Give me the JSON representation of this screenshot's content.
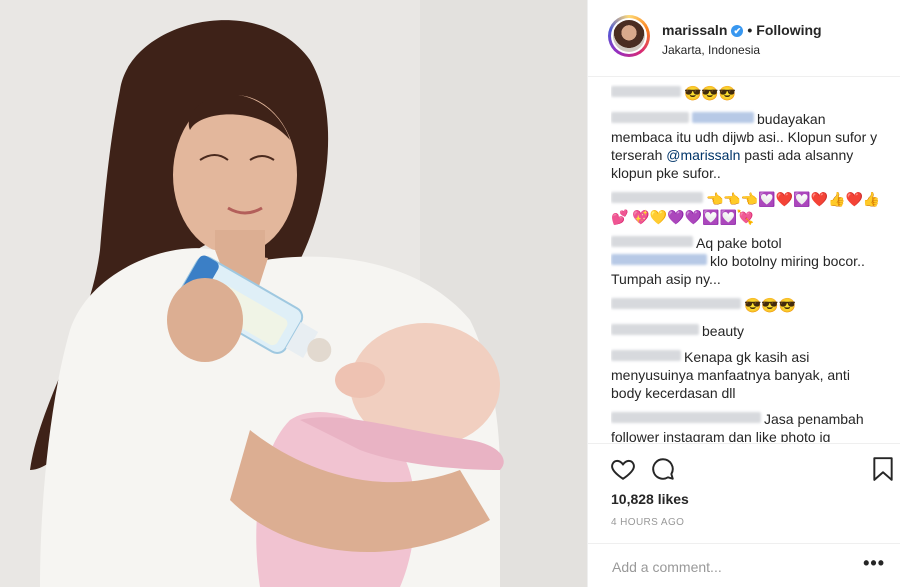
{
  "post": {
    "photo_alt": "Photo of a mother feeding a baby with a bottle",
    "header": {
      "username": "marissaln",
      "verified_glyph": "✔",
      "separator": "•",
      "follow_state": "Following",
      "location": "Jakarta, Indonesia"
    },
    "comments": [
      {
        "text": "😎😎😎"
      },
      {
        "text": "budayakan membaca itu udh dijwb asi.. Klopun sufor y terserah ",
        "mention": "@marissaln",
        "text_after": " pasti ada alsanny klopun pke sufor.."
      },
      {
        "text": "👈👈👈💟❤️💟❤️👍❤️👍💕 💖💛💜💜💟💟💘"
      },
      {
        "text": "Aq pake botol ",
        "text_after": "klo botolny miring bocor.. Tumpah asip ny..."
      },
      {
        "text": "😎😎😎"
      },
      {
        "text": "beauty"
      },
      {
        "text": "Kenapa gk kasih asi menyusuinya manfaatnya banyak, anti body kecerdasan dll"
      },
      {
        "text": "Jasa penambah follower instagram dan like photo ig perphost cocok untuk kalian yang mau jd"
      }
    ],
    "likes": "10,828 likes",
    "timestamp": "4 HOURS AGO",
    "comment_placeholder": "Add a comment...",
    "more_label": "•••",
    "icons": {
      "like": "heart-icon",
      "comment": "comment-bubble-icon",
      "save": "bookmark-icon"
    }
  }
}
